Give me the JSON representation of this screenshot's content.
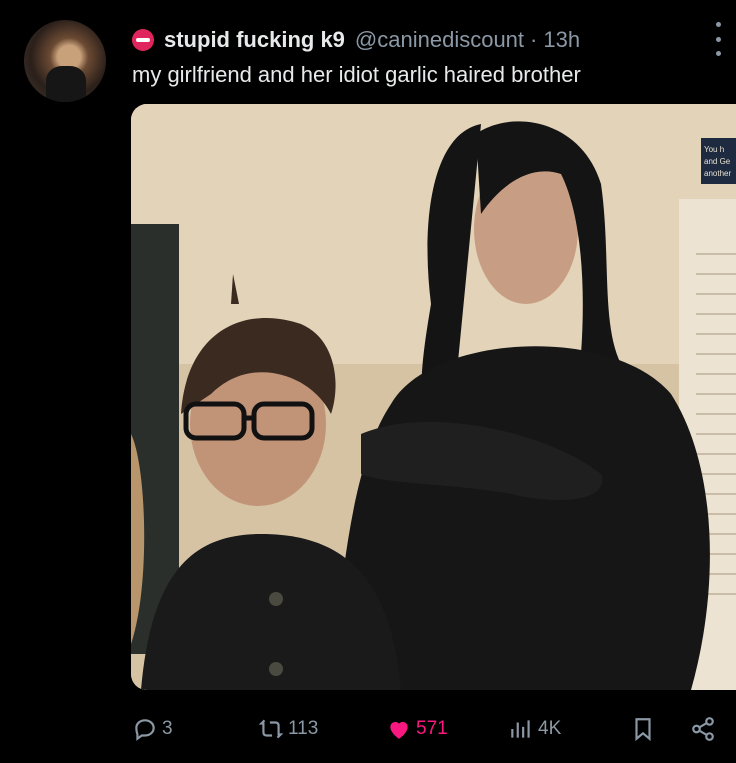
{
  "tweet": {
    "display_name": "stupid fucking k9",
    "handle": "@caninediscount",
    "separator": "·",
    "time": "13h",
    "text": "my girlfriend and her idiot garlic haired brother",
    "image_sign_text": "\"You h... and Ge... another"
  },
  "actions": {
    "replies": "3",
    "reposts": "113",
    "likes": "571",
    "views": "4K"
  },
  "colors": {
    "background": "#000000",
    "text": "#e7e9ea",
    "muted": "#8b98a5",
    "like": "#f91880"
  },
  "icons": [
    "more-options-icon",
    "reply-icon",
    "repost-icon",
    "heart-icon",
    "views-icon",
    "bookmark-icon",
    "share-icon"
  ]
}
